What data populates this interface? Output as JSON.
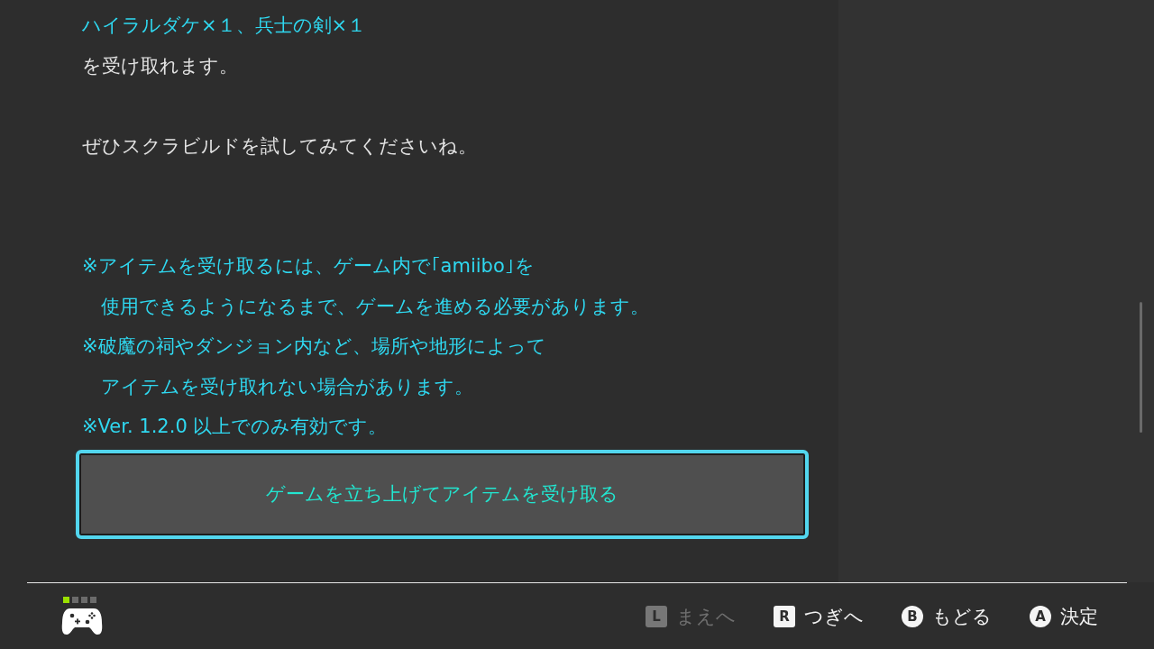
{
  "lines": [
    {
      "kind": "accent",
      "text": "ハイラルダケ×１、兵士の剣×１"
    },
    {
      "kind": "plain",
      "text": "を受け取れます。"
    },
    {
      "kind": "blank"
    },
    {
      "kind": "plain",
      "text": "ぜひスクラビルドを試してみてくださいね。"
    },
    {
      "kind": "blank"
    },
    {
      "kind": "blank"
    },
    {
      "kind": "accent",
      "text": "※アイテムを受け取るには、ゲーム内で｢amiibo｣を"
    },
    {
      "kind": "accent",
      "text": "　使用できるようになるまで、ゲームを進める必要があります。"
    },
    {
      "kind": "accent",
      "text": "※破魔の祠やダンジョン内など、場所や地形によって"
    },
    {
      "kind": "accent",
      "text": "　アイテムを受け取れない場合があります。"
    },
    {
      "kind": "accent",
      "text": "※Ver. 1.2.0 以上でのみ有効です。"
    }
  ],
  "action_button": {
    "label": "ゲームを立ち上げてアイテムを受け取る",
    "selected": true
  },
  "footer": {
    "player_lights": [
      {
        "on": true
      },
      {
        "on": false
      },
      {
        "on": false
      },
      {
        "on": false
      }
    ],
    "controls": [
      {
        "kind": "square",
        "key": "L",
        "label": "まえへ",
        "disabled": true
      },
      {
        "kind": "square",
        "key": "R",
        "label": "つぎへ",
        "disabled": false
      },
      {
        "kind": "circle",
        "key": "B",
        "label": "もどる",
        "disabled": false
      },
      {
        "kind": "circle",
        "key": "A",
        "label": "決定",
        "disabled": false
      }
    ]
  }
}
